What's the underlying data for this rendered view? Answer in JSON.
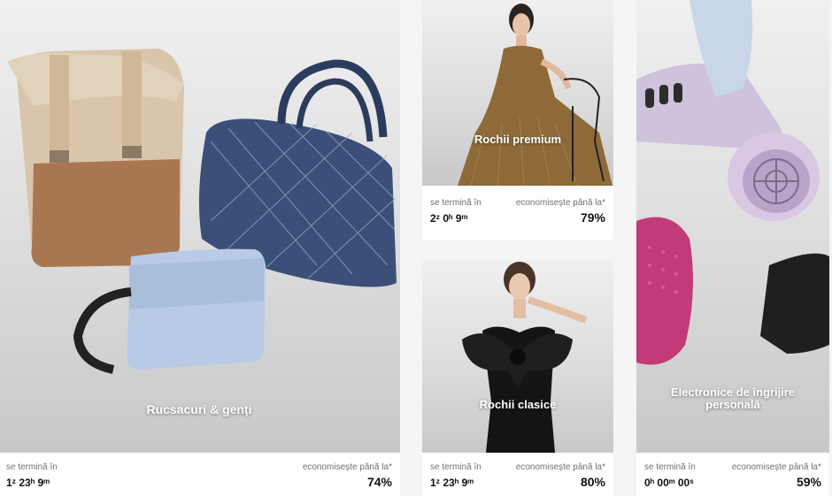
{
  "cards": [
    {
      "title": "Rucsacuri & genți",
      "ends_label": "se termină în",
      "timer": "1ᶻ 23ʰ 9ᵐ",
      "save_label": "economisește până la*",
      "discount": "74%"
    },
    {
      "title": "Rochii premium",
      "ends_label": "se termină în",
      "timer": "2ᶻ 0ʰ 9ᵐ",
      "save_label": "economisește până la*",
      "discount": "79%"
    },
    {
      "title": "Rochii clasice",
      "ends_label": "se termină în",
      "timer": "1ᶻ 23ʰ 9ᵐ",
      "save_label": "economisește până la*",
      "discount": "80%"
    },
    {
      "title": "Electronice de îngrijire personală",
      "ends_label": "se termină în",
      "timer": "0ʰ 00ᵐ 00ˢ",
      "save_label": "economisește până la*",
      "discount": "59%"
    }
  ],
  "colors": {
    "card_bg": "#ffffff",
    "page_bg": "#f5f5f5",
    "title_text": "#ffffff"
  }
}
